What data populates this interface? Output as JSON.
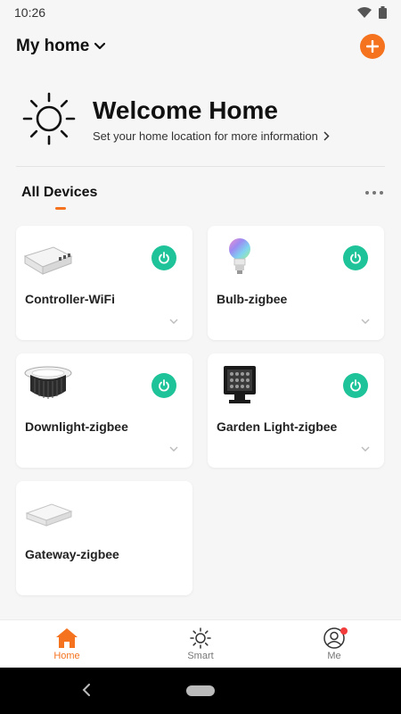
{
  "status": {
    "time": "10:26"
  },
  "header": {
    "home_name": "My home"
  },
  "welcome": {
    "title": "Welcome Home",
    "subtitle": "Set your home location for more information"
  },
  "section": {
    "title": "All Devices"
  },
  "devices": [
    {
      "name": "Controller-WiFi",
      "has_power": true,
      "icon": "controller-icon"
    },
    {
      "name": "Bulb-zigbee",
      "has_power": true,
      "icon": "bulb-icon"
    },
    {
      "name": "Downlight-zigbee",
      "has_power": true,
      "icon": "downlight-icon"
    },
    {
      "name": "Garden Light-zigbee",
      "has_power": true,
      "icon": "floodlight-icon"
    },
    {
      "name": "Gateway-zigbee",
      "has_power": false,
      "icon": "gateway-icon"
    }
  ],
  "tabs": [
    {
      "label": "Home",
      "active": true
    },
    {
      "label": "Smart",
      "active": false
    },
    {
      "label": "Me",
      "active": false,
      "badge": true
    }
  ],
  "colors": {
    "accent": "#f5731f",
    "power_on": "#1fc39a",
    "badge": "#f23b3b",
    "background": "#f6f6f6"
  }
}
